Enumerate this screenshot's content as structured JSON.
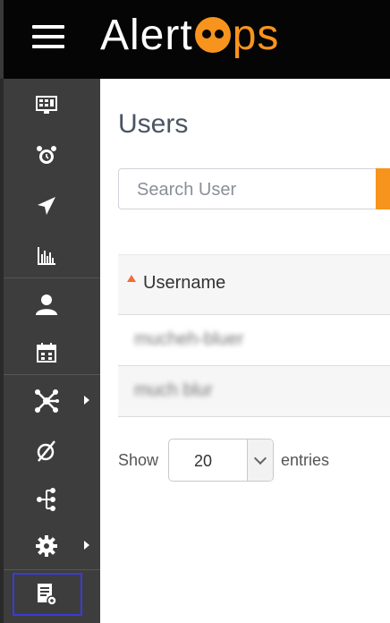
{
  "header": {
    "logo_text_1": "Alert",
    "logo_text_2": "ps",
    "menu_icon": "hamburger-icon",
    "accent": "#f7941d"
  },
  "sidebar": {
    "items": [
      {
        "icon": "dashboard-monitor-icon"
      },
      {
        "icon": "alarm-clock-icon"
      },
      {
        "icon": "paper-plane-icon"
      },
      {
        "icon": "bar-chart-icon"
      },
      {
        "icon": "user-icon"
      },
      {
        "icon": "calendar-icon"
      },
      {
        "icon": "integrations-hub-icon",
        "has_submenu": true
      },
      {
        "icon": "diameter-null-icon"
      },
      {
        "icon": "workflow-tree-icon"
      },
      {
        "icon": "settings-gear-icon",
        "has_submenu": true
      },
      {
        "icon": "report-settings-icon",
        "selected": true
      }
    ]
  },
  "main": {
    "title": "Users",
    "search": {
      "placeholder": "Search User",
      "value": ""
    },
    "table": {
      "header": "Username",
      "rows": [
        "mucheh-bluer",
        "much blur"
      ]
    },
    "paging": {
      "show_label": "Show",
      "page_size": "20",
      "entries_label": "entries"
    }
  }
}
